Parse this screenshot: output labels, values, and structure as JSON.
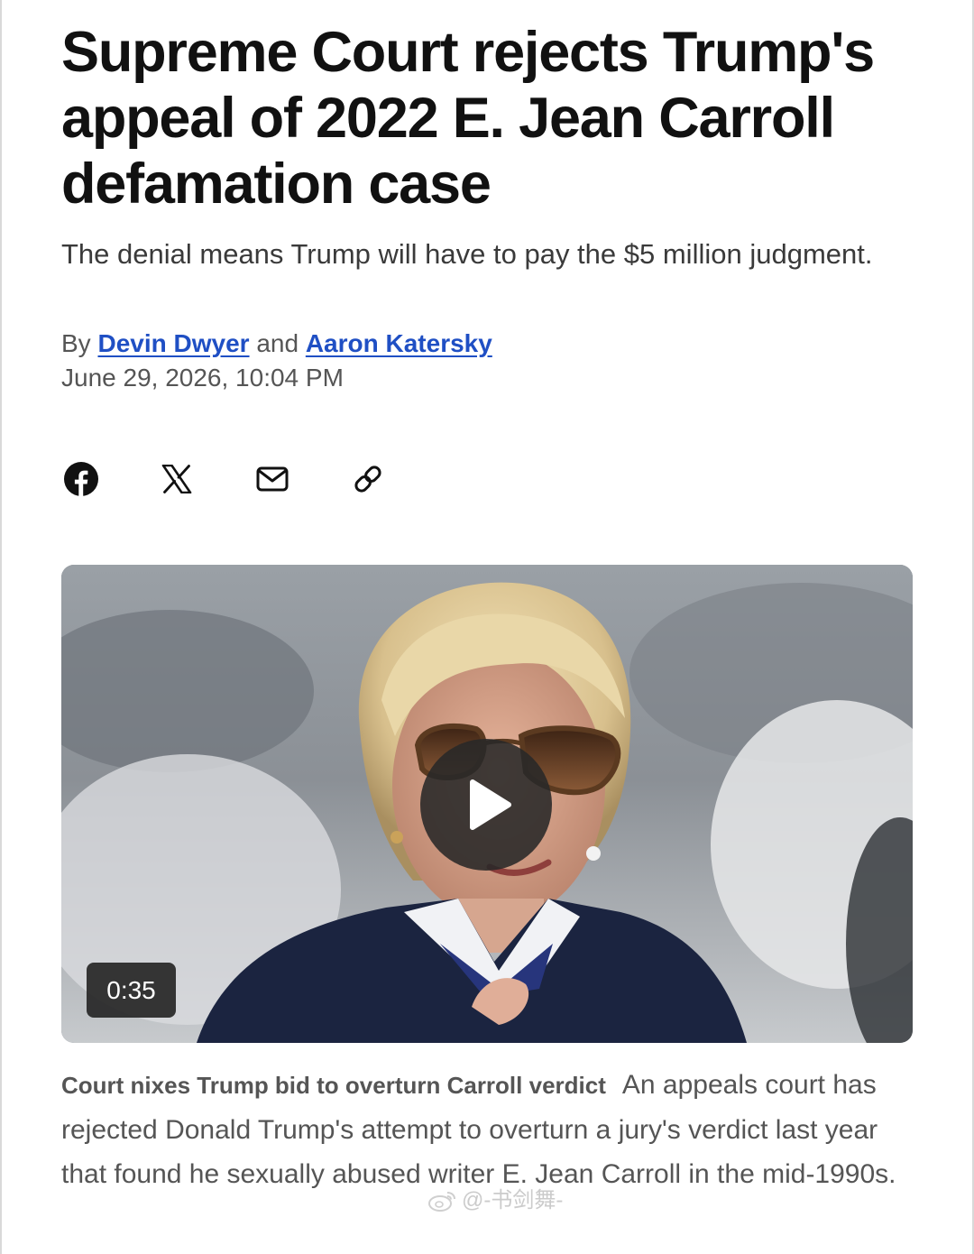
{
  "article": {
    "headline": "Supreme Court rejects Trump's appeal of 2022 E. Jean Carroll defamation case",
    "subheadline": "The denial means Trump will have to pay the $5 million judgment.",
    "byline": {
      "prefix": "By",
      "author_1": "Devin Dwyer",
      "conjunction": "and",
      "author_2": "Aaron Katersky"
    },
    "date": "June 29, 2026, 10:04 PM"
  },
  "share": {
    "icons": [
      "facebook-icon",
      "x-icon",
      "email-icon",
      "link-icon"
    ]
  },
  "video": {
    "duration": "0:35",
    "caption_title": "Court nixes Trump bid to overturn Carroll verdict",
    "caption_text": "An appeals court has rejected Donald Trump's attempt to overturn a jury's verdict last year that found he sexually abused writer E. Jean Carroll in the mid-1990s."
  },
  "watermark": {
    "text": "@-书剑舞-"
  },
  "colors": {
    "link": "#1f4fc4",
    "headline": "#111111",
    "body_text": "#555555"
  }
}
